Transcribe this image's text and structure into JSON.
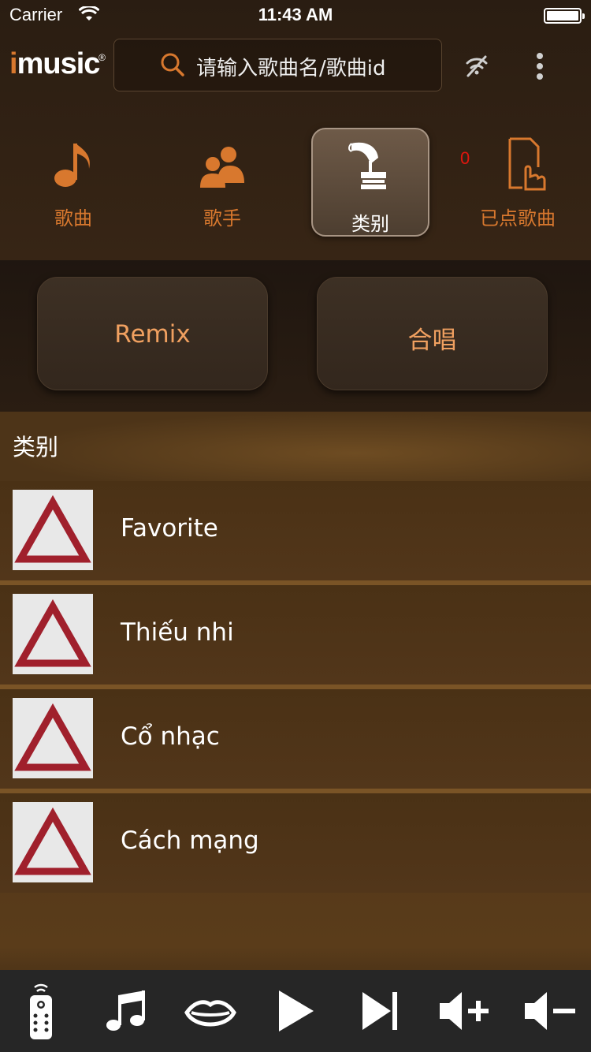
{
  "status_bar": {
    "carrier": "Carrier",
    "time": "11:43 AM"
  },
  "header": {
    "logo_text": "music",
    "logo_i": "i",
    "logo_mark": "®",
    "search_placeholder": "请输入歌曲名/歌曲id"
  },
  "tabs": [
    {
      "label": "歌曲",
      "icon": "music-note-icon"
    },
    {
      "label": "歌手",
      "icon": "singers-icon"
    },
    {
      "label": "类别",
      "icon": "gramophone-icon",
      "active": true
    },
    {
      "label": "已点歌曲",
      "icon": "selected-songs-icon",
      "badge": "0"
    }
  ],
  "sub_buttons": [
    {
      "label": "Remix"
    },
    {
      "label": "合唱"
    }
  ],
  "category": {
    "title": "类别",
    "items": [
      {
        "label": "Favorite"
      },
      {
        "label": "Thiếu nhi"
      },
      {
        "label": "Cổ nhạc"
      },
      {
        "label": "Cách mạng"
      }
    ]
  },
  "bottom_bar": [
    "remote-icon",
    "music-icon",
    "lips-icon",
    "play-icon",
    "next-icon",
    "volume-up-icon",
    "volume-down-icon"
  ],
  "colors": {
    "accent": "#d8782e",
    "badge": "#e0160e",
    "placeholder_red": "#a0202c"
  }
}
